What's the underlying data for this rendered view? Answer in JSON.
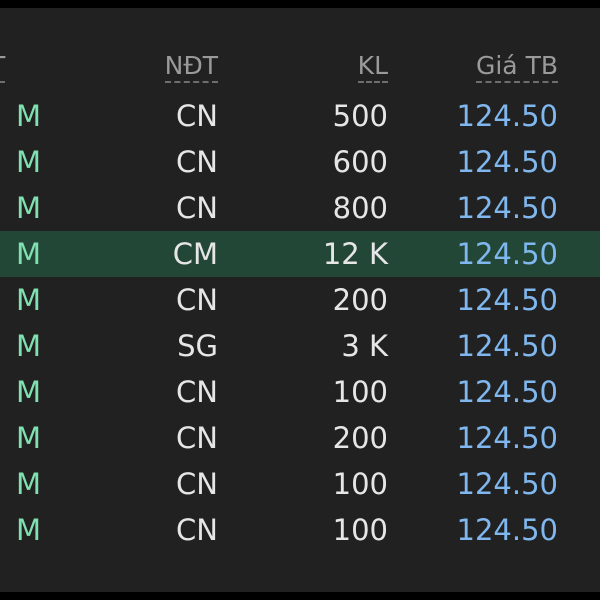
{
  "table": {
    "headers": [
      "T",
      "NĐT",
      "KL",
      "Giá TB"
    ],
    "selected_row_index": 3,
    "rows": [
      {
        "side": "M",
        "investor": "CN",
        "volume": "500",
        "price": "124.50"
      },
      {
        "side": "M",
        "investor": "CN",
        "volume": "600",
        "price": "124.50"
      },
      {
        "side": "M",
        "investor": "CN",
        "volume": "800",
        "price": "124.50"
      },
      {
        "side": "M",
        "investor": "CM",
        "volume": "12 K",
        "price": "124.50"
      },
      {
        "side": "M",
        "investor": "CN",
        "volume": "200",
        "price": "124.50"
      },
      {
        "side": "M",
        "investor": "SG",
        "volume": "3 K",
        "price": "124.50"
      },
      {
        "side": "M",
        "investor": "CN",
        "volume": "100",
        "price": "124.50"
      },
      {
        "side": "M",
        "investor": "CN",
        "volume": "200",
        "price": "124.50"
      },
      {
        "side": "M",
        "investor": "CN",
        "volume": "100",
        "price": "124.50"
      },
      {
        "side": "M",
        "investor": "CN",
        "volume": "100",
        "price": "124.50"
      }
    ]
  },
  "colors": {
    "background": "#212121",
    "header_text": "#9a9a9a",
    "buy_side": "#7fe1b0",
    "price": "#7fb7ee",
    "selected_row": "#234737"
  }
}
